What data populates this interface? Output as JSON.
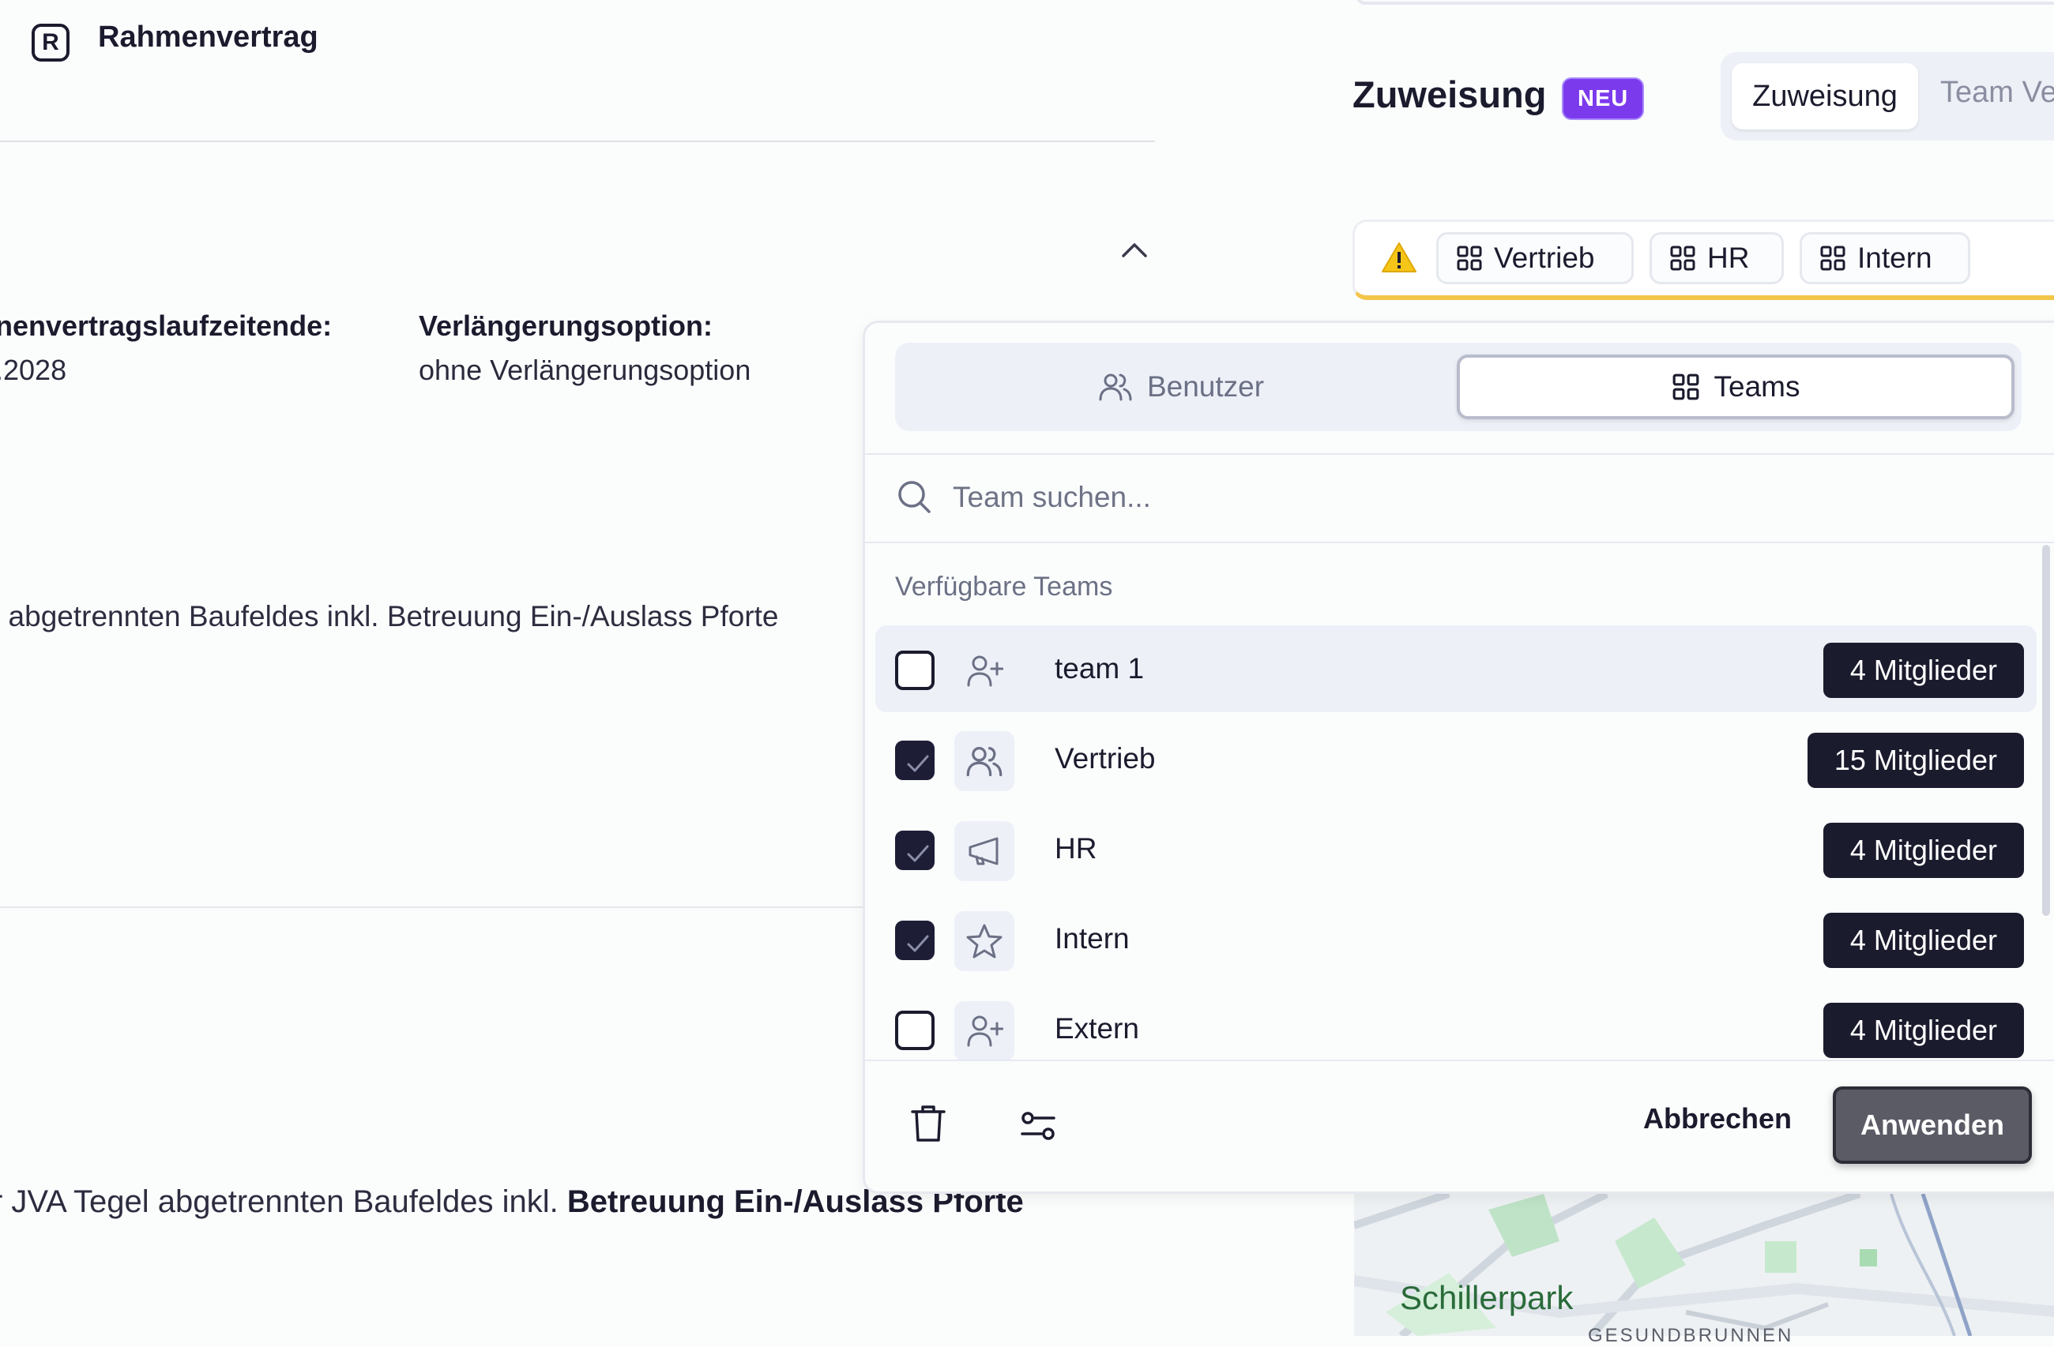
{
  "document": {
    "title": "Rahmenvertrag",
    "fields": [
      {
        "label": "nenvertragslaufzeitende:",
        "value": ".2028"
      },
      {
        "label": "Verlängerungsoption:",
        "value": "ohne Verlängerungsoption"
      }
    ],
    "description_line": ". abgetrennten Baufeldes inkl. Betreuung Ein-/Auslass Pforte",
    "description_bottom_prefix": "r JVA Tegel abgetrennten Baufeldes inkl. ",
    "description_bottom_bold": "Betreuung Ein-/Auslass Pforte"
  },
  "header": {
    "title": "Zuweisung",
    "badge": "NEU",
    "tabs": [
      {
        "label": "Zuweisung",
        "active": true
      },
      {
        "label": "Team Ve",
        "active": false
      }
    ]
  },
  "assigned_chips": {
    "warning_icon": "warning-icon",
    "items": [
      "Vertrieb",
      "HR",
      "Intern"
    ]
  },
  "popover": {
    "segments": {
      "users": "Benutzer",
      "teams": "Teams",
      "active": "teams"
    },
    "search": {
      "placeholder": "Team suchen...",
      "value": ""
    },
    "section_label": "Verfügbare Teams",
    "teams": [
      {
        "name": "team 1",
        "members": "4 Mitglieder",
        "checked": false,
        "icon": "user-plus-icon"
      },
      {
        "name": "Vertrieb",
        "members": "15 Mitglieder",
        "checked": true,
        "icon": "users-icon"
      },
      {
        "name": "HR",
        "members": "4 Mitglieder",
        "checked": true,
        "icon": "megaphone-icon"
      },
      {
        "name": "Intern",
        "members": "4 Mitglieder",
        "checked": true,
        "icon": "star-icon"
      },
      {
        "name": "Extern",
        "members": "4 Mitglieder",
        "checked": false,
        "icon": "user-plus-icon"
      }
    ],
    "footer": {
      "cancel": "Abbrechen",
      "apply": "Anwenden"
    }
  },
  "map": {
    "label": "Schillerpark",
    "district": "GESUNDBRUNNEN"
  },
  "colors": {
    "accent": "#7c3aed",
    "dark": "#1b1b2e",
    "warning": "#f3c64a"
  }
}
